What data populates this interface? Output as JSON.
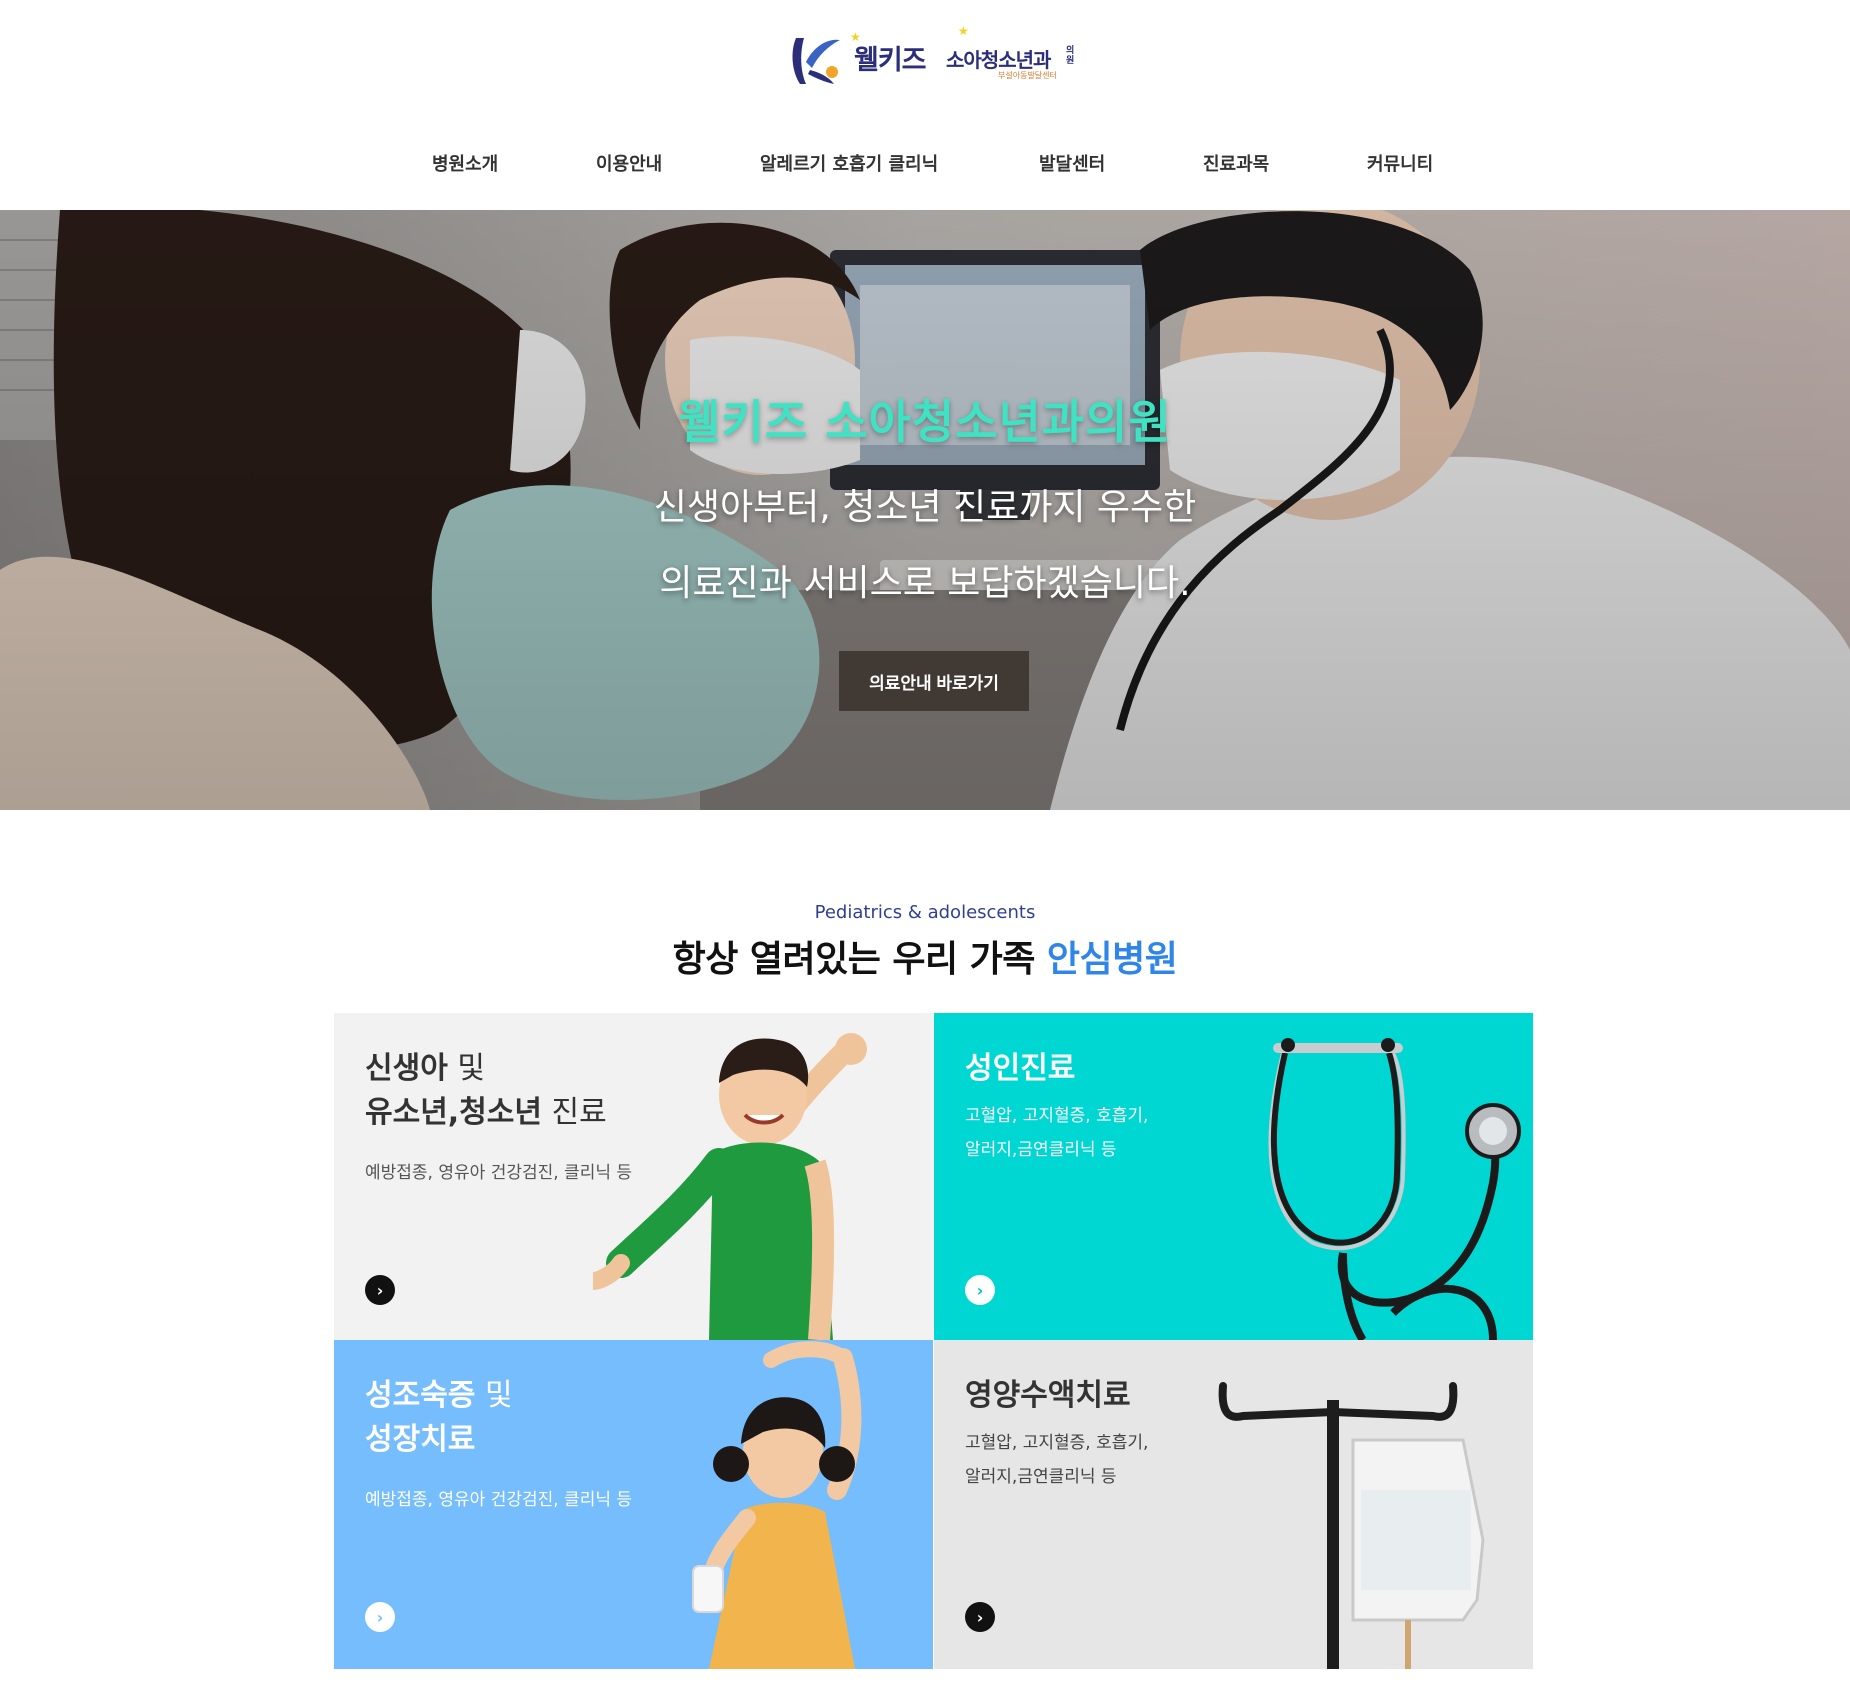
{
  "header": {
    "logo": {
      "name": "웰키즈",
      "subtitle": "소아청소년과",
      "side_text": "의원",
      "tagline": "부설아동발달센터"
    },
    "nav": [
      {
        "label": "병원소개"
      },
      {
        "label": "이용안내"
      },
      {
        "label": "알레르기 호흡기 클리닉"
      },
      {
        "label": "발달센터"
      },
      {
        "label": "진료과목"
      },
      {
        "label": "커뮤니티"
      }
    ]
  },
  "hero": {
    "title": "웰키즈 소아청소년과의원",
    "line1": "신생아부터, 청소년 진료까지 우수한",
    "line2": "의료진과 서비스로 보답하겠습니다.",
    "button_label": "의료안내 바로가기",
    "title_color": "#3fe3c4"
  },
  "section": {
    "eyebrow": "Pediatrics & adolescents",
    "title_main": "항상 열려있는 우리 가족 ",
    "title_accent": "안심병원",
    "accent_color": "#2f86e8"
  },
  "cards": [
    {
      "title_line1_bold": "신생아",
      "title_line1_rest": " 및",
      "title_line2_bold": "유소년,청소년",
      "title_line2_rest": " 진료",
      "desc": "예방접종, 영유아 건강검진, 클리닉 등",
      "bg": "#f2f2f2",
      "icon": "chevron-right-icon"
    },
    {
      "title_line1_bold": "성인진료",
      "desc_line1": "고혈압, 고지혈증, 호흡기,",
      "desc_line2": "알러지,금연클리닉 등",
      "bg": "#00d6d2",
      "icon": "chevron-right-icon"
    },
    {
      "title_line1_bold": "성조숙증",
      "title_line1_rest": " 및",
      "title_line2_bold": "성장치료",
      "desc": "예방접종, 영유아 건강검진, 클리닉 등",
      "bg": "#76bdfd",
      "icon": "chevron-right-icon"
    },
    {
      "title_line1_bold": "영양수액치료",
      "desc_line1": "고혈압, 고지혈증, 호흡기,",
      "desc_line2": "알러지,금연클리닉 등",
      "bg": "#e6e6e6",
      "icon": "chevron-right-icon"
    }
  ]
}
